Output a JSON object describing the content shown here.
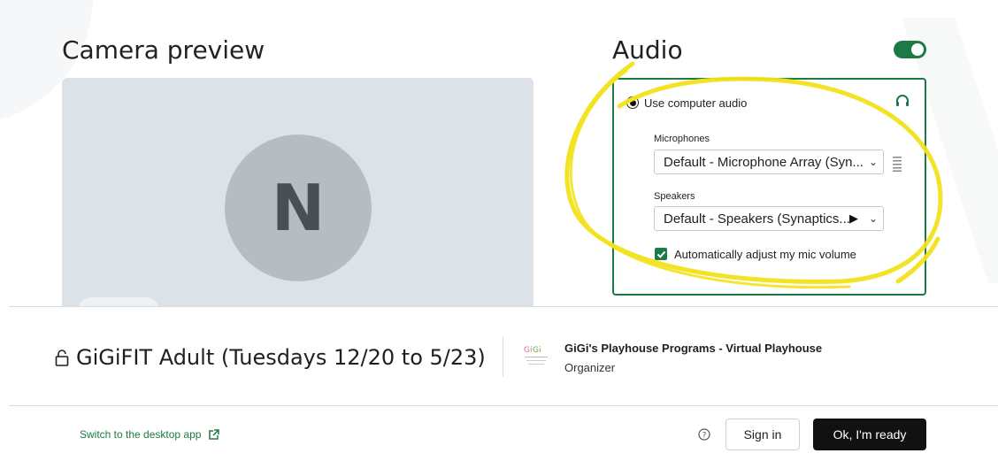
{
  "camera": {
    "title": "Camera preview",
    "avatar_initial": "N"
  },
  "audio": {
    "title": "Audio",
    "enabled": true,
    "source_label": "Use computer audio",
    "microphones_label": "Microphones",
    "microphone_value": "Default - Microphone Array (Syn...",
    "speakers_label": "Speakers",
    "speaker_value": "Default - Speakers (Synaptics...",
    "auto_adjust_label": "Automatically adjust my mic volume",
    "auto_adjust_checked": true
  },
  "meeting": {
    "title": "GiGiFIT Adult (Tuesdays 12/20 to 5/23)",
    "organizer_name": "GiGi's Playhouse Programs - Virtual Playhouse",
    "organizer_role": "Organizer"
  },
  "footer": {
    "desktop_link": "Switch to the desktop app",
    "sign_in": "Sign in",
    "ready": "Ok, I'm ready"
  },
  "colors": {
    "accent": "#1c7a46",
    "annotation": "#f2e21a"
  }
}
